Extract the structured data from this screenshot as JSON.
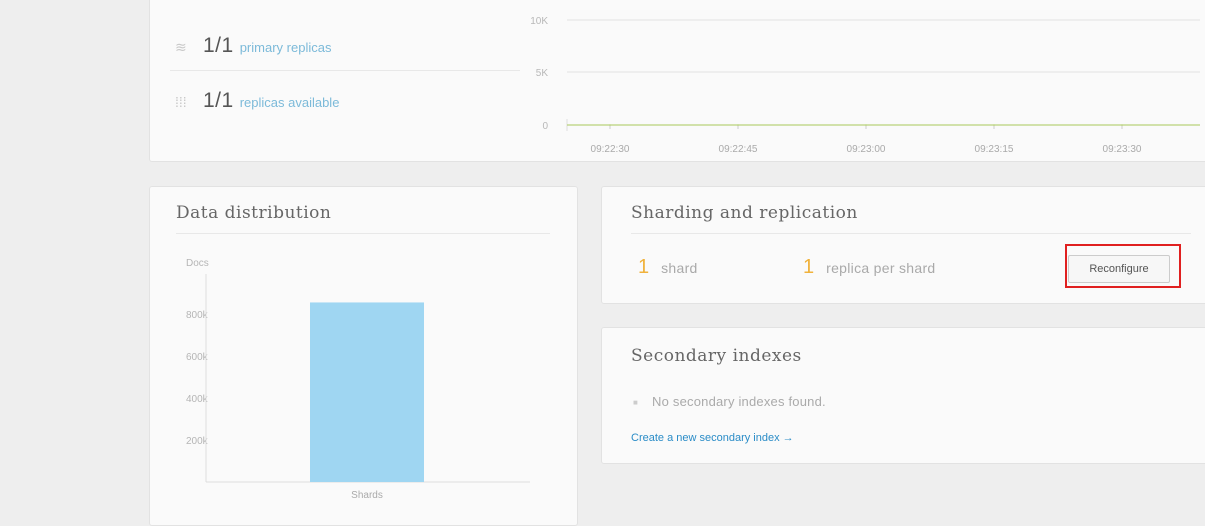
{
  "status": {
    "primary": {
      "icon": "layers-icon",
      "value": "1/1",
      "label": "primary replicas"
    },
    "available": {
      "icon": "grid-icon",
      "value": "1/1",
      "label": "replicas available"
    }
  },
  "chart_data": [
    {
      "type": "line",
      "yticks": [
        "10K",
        "5K",
        "0"
      ],
      "ylim": [
        0,
        10000
      ],
      "x": [
        "09:22:30",
        "09:22:45",
        "09:23:00",
        "09:23:15",
        "09:23:30"
      ],
      "series": [
        {
          "values": [
            0,
            0,
            0,
            0,
            0
          ]
        }
      ],
      "grid": true
    },
    {
      "type": "bar",
      "title": "Data distribution",
      "ylabel": "Docs",
      "xlabel": "Shards",
      "yticks": [
        "800k",
        "600k",
        "400k",
        "200k"
      ],
      "ylim": [
        0,
        1000000
      ],
      "categories": [
        ""
      ],
      "values": [
        855000
      ]
    }
  ],
  "sharding": {
    "title": "Sharding and replication",
    "shards_value": "1",
    "shards_label": "shard",
    "replicas_value": "1",
    "replicas_label": "replica per shard",
    "reconfigure_label": "Reconfigure"
  },
  "secondary": {
    "title": "Secondary indexes",
    "empty_text": "No secondary indexes found.",
    "create_link": "Create a new secondary index →"
  },
  "colors": {
    "accent": "#f0b23c",
    "link": "#2a8cc7",
    "bar": "#9fd6f2",
    "highlight": "#e02020"
  }
}
